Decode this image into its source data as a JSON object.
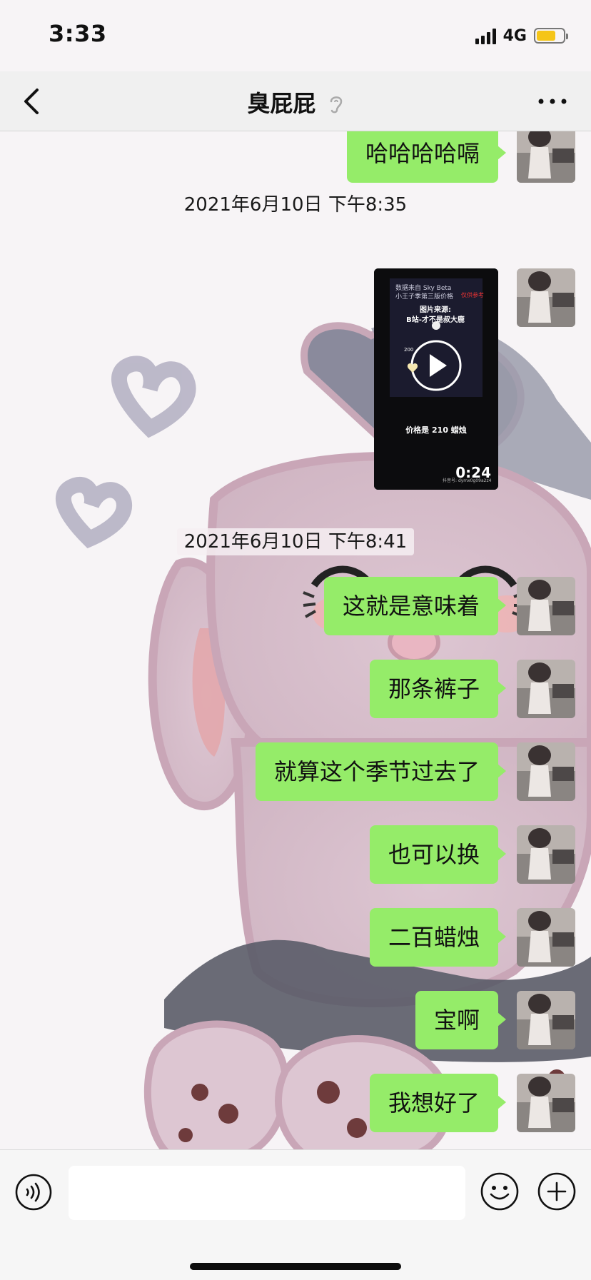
{
  "status_bar": {
    "time": "3:33",
    "network": "4G",
    "battery_level": 0.72
  },
  "nav": {
    "title": "臭屁屁",
    "icons": {
      "back": "chevron-left-icon",
      "mute": "ear-mute-icon",
      "more": "more-dots-icon"
    }
  },
  "chat": {
    "top_message": "哈哈哈哈嗝",
    "timestamps": [
      "2021年6月10日 下午8:35",
      "2021年6月10日 下午8:41"
    ],
    "video": {
      "duration": "0:24",
      "lines": [
        "数据来自 Sky Beta",
        "小王子季第三版价格",
        "仅供参考",
        "图片来源:",
        "B站-才不是叔大鹿",
        "200",
        "价格是 210 蜡烛",
        "抖音号: dymx0g09a2z4"
      ]
    },
    "messages": [
      "这就是意味着",
      "那条裤子",
      "就算这个季节过去了",
      "也可以换",
      "二百蜡烛",
      "宝啊",
      "我想好了"
    ]
  },
  "input": {
    "placeholder": "",
    "icons": {
      "voice": "voice-icon",
      "emoji": "emoji-icon",
      "plus": "plus-icon"
    }
  },
  "colors": {
    "bubble": "#95ec69",
    "nav_bg": "#efefef",
    "input_bg": "#f6f6f6"
  }
}
